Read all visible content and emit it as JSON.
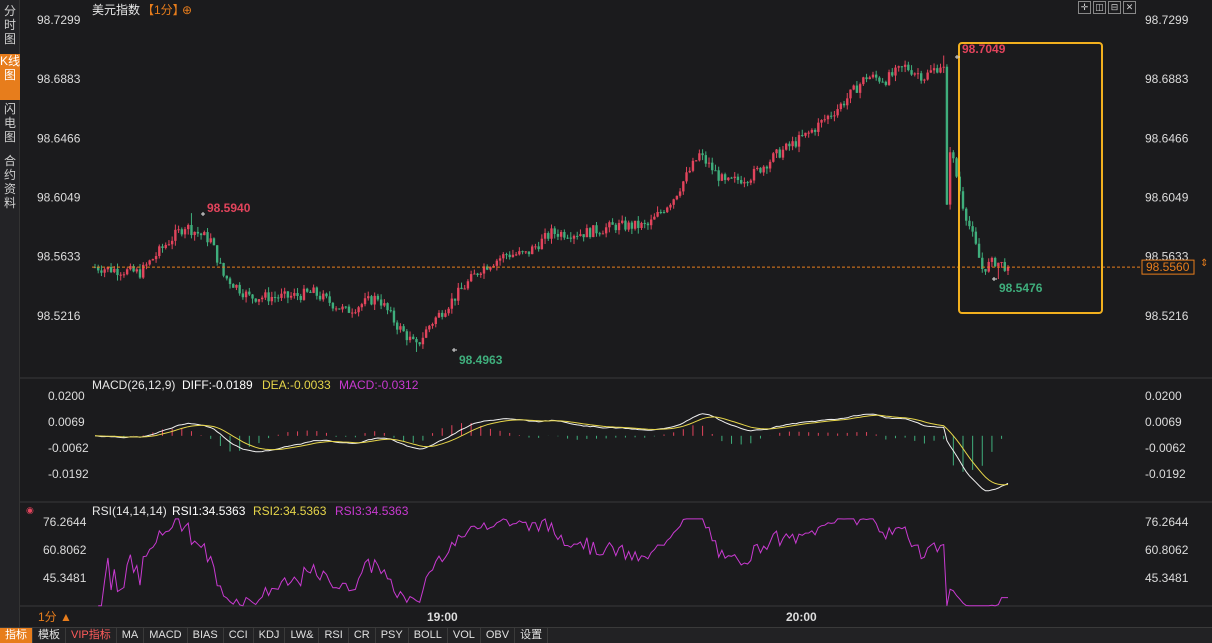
{
  "sidebar": {
    "tabs": [
      {
        "label": "分时图",
        "active": false
      },
      {
        "label": "K线图",
        "active": true
      },
      {
        "label": "闪电图",
        "active": false
      },
      {
        "label": "合约资料",
        "active": false
      }
    ]
  },
  "header": {
    "instrument": "美元指数",
    "period": "【1分】",
    "toolbar_icons": [
      "crosshair-icon",
      "bars-icon",
      "split-icon",
      "close-icon"
    ]
  },
  "price_axis": {
    "ticks": [
      "98.7299",
      "98.6883",
      "98.6466",
      "98.6049",
      "98.5633",
      "98.5216"
    ],
    "current_price": "98.5560"
  },
  "annotations": {
    "high_1": "98.5940",
    "low_1": "98.4963",
    "high_2": "98.7049",
    "low_2": "98.5476"
  },
  "macd": {
    "header": "MACD(26,12,9)",
    "diff": "DIFF:-0.0189",
    "dea": "DEA:-0.0033",
    "macd": "MACD:-0.0312",
    "ticks": [
      "0.0200",
      "0.0069",
      "-0.0062",
      "-0.0192"
    ]
  },
  "rsi": {
    "header": "RSI(14,14,14)",
    "rsi1": "RSI1:34.5363",
    "rsi2": "RSI2:34.5363",
    "rsi3": "RSI3:34.5363",
    "ticks": [
      "76.2644",
      "60.8062",
      "45.3481"
    ]
  },
  "time_axis": {
    "period_label": "1分 ▲",
    "labels": [
      "19:00",
      "20:00"
    ]
  },
  "bottom_tabs": [
    {
      "label": "指标",
      "active": true,
      "vip": false
    },
    {
      "label": "模板",
      "active": false,
      "vip": false
    },
    {
      "label": "VIP指标",
      "active": false,
      "vip": true
    },
    {
      "label": "MA",
      "active": false,
      "vip": false
    },
    {
      "label": "MACD",
      "active": false,
      "vip": false
    },
    {
      "label": "BIAS",
      "active": false,
      "vip": false
    },
    {
      "label": "CCI",
      "active": false,
      "vip": false
    },
    {
      "label": "KDJ",
      "active": false,
      "vip": false
    },
    {
      "label": "LW&",
      "active": false,
      "vip": false
    },
    {
      "label": "RSI",
      "active": false,
      "vip": false
    },
    {
      "label": "CR",
      "active": false,
      "vip": false
    },
    {
      "label": "PSY",
      "active": false,
      "vip": false
    },
    {
      "label": "BOLL",
      "active": false,
      "vip": false
    },
    {
      "label": "VOL",
      "active": false,
      "vip": false
    },
    {
      "label": "OBV",
      "active": false,
      "vip": false
    },
    {
      "label": "设置",
      "active": false,
      "vip": false
    }
  ],
  "colors": {
    "up": "#e2445c",
    "down": "#3fae7c",
    "dea": "#e6d54a",
    "macd_label": "#c93ad1",
    "rsi_line": "#c93ad1",
    "highlight_box": "#f2b01e",
    "current_price": "#e77d1c"
  },
  "chart_data": {
    "type": "candlestick",
    "price_range": [
      98.49,
      98.73
    ],
    "open_price": 98.556,
    "close_price": 98.556,
    "high": 98.7049,
    "low": 98.4963,
    "reference_line": 98.556,
    "path_keypoints": [
      [
        0,
        98.556
      ],
      [
        14,
        98.552
      ],
      [
        22,
        98.572
      ],
      [
        28,
        98.585
      ],
      [
        36,
        98.575
      ],
      [
        40,
        98.55
      ],
      [
        48,
        98.535
      ],
      [
        60,
        98.535
      ],
      [
        68,
        98.538
      ],
      [
        78,
        98.525
      ],
      [
        88,
        98.535
      ],
      [
        94,
        98.515
      ],
      [
        100,
        98.5
      ],
      [
        104,
        98.515
      ],
      [
        112,
        98.535
      ],
      [
        120,
        98.555
      ],
      [
        128,
        98.565
      ],
      [
        134,
        98.565
      ],
      [
        142,
        98.58
      ],
      [
        152,
        98.58
      ],
      [
        162,
        98.585
      ],
      [
        172,
        98.585
      ],
      [
        180,
        98.605
      ],
      [
        188,
        98.635
      ],
      [
        196,
        98.615
      ],
      [
        204,
        98.62
      ],
      [
        212,
        98.635
      ],
      [
        222,
        98.65
      ],
      [
        232,
        98.67
      ],
      [
        240,
        98.69
      ],
      [
        246,
        98.688
      ],
      [
        252,
        98.697
      ],
      [
        258,
        98.69
      ],
      [
        264,
        98.7
      ],
      [
        266,
        98.64
      ],
      [
        270,
        98.6
      ],
      [
        276,
        98.555
      ],
      [
        280,
        98.56
      ],
      [
        284,
        98.556
      ]
    ],
    "macd": {
      "diff_range": [
        -0.024,
        0.024
      ],
      "last_diff": -0.0189,
      "last_dea": -0.0033,
      "last_macd": -0.0312
    },
    "rsi": {
      "range": [
        30,
        80
      ],
      "last": 34.5363
    }
  }
}
